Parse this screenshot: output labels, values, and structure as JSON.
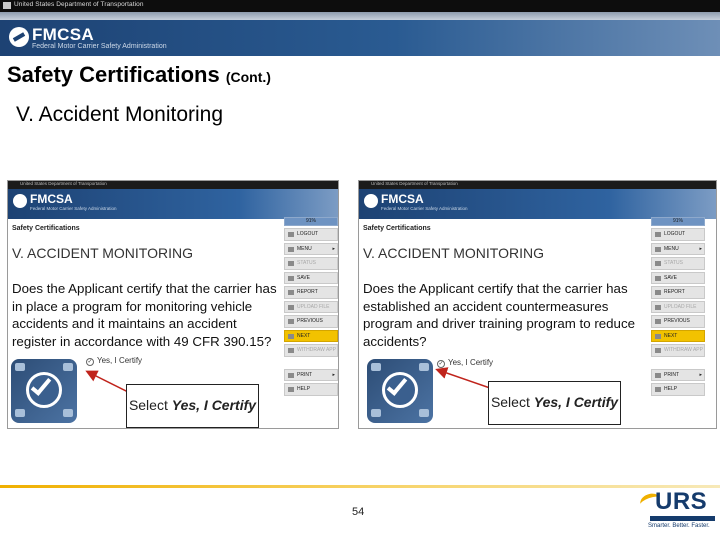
{
  "banner": {
    "dept_label": "United States Department of Transportation",
    "logo_text": "FMCSA",
    "logo_subtitle": "Federal Motor Carrier Safety Administration"
  },
  "slide": {
    "title": "Safety Certifications",
    "title_suffix": "(Cont.)",
    "subtitle": "V. Accident Monitoring"
  },
  "panels": [
    {
      "dept_label": "United States Department of Transportation",
      "logo_text": "FMCSA",
      "logo_subtitle": "Federal Motor Carrier Safety Administration",
      "breadcrumb": "Safety Certifications",
      "heading": "V. ACCIDENT MONITORING",
      "question": "Does the Applicant certify that the carrier has in place a program for monitoring vehicle accidents and it maintains an accident register in accordance with 49 CFR 390.15?",
      "checkbox_label": "Yes, I Certify",
      "menu": {
        "progress": "91%",
        "items": [
          "LOGOUT",
          "MENU",
          "STATUS",
          "SAVE",
          "REPORT",
          "UPLOAD FILE",
          "PREVIOUS",
          "NEXT",
          "WITHDRAW APP",
          "PRINT",
          "HELP"
        ]
      },
      "callout_lead": "Select ",
      "callout_emph": "Yes, I Certify"
    },
    {
      "dept_label": "United States Department of Transportation",
      "logo_text": "FMCSA",
      "logo_subtitle": "Federal Motor Carrier Safety Administration",
      "breadcrumb": "Safety Certifications",
      "heading": "V. ACCIDENT MONITORING",
      "question": "Does the Applicant certify that the carrier has established an accident countermeasures program and driver training program to reduce accidents?",
      "checkbox_label": "Yes, I Certify",
      "menu": {
        "progress": "91%",
        "items": [
          "LOGOUT",
          "MENU",
          "STATUS",
          "SAVE",
          "REPORT",
          "UPLOAD FILE",
          "PREVIOUS",
          "NEXT",
          "WITHDRAW APP",
          "PRINT",
          "HELP"
        ]
      },
      "callout_lead": "Select ",
      "callout_emph": "Yes, I Certify"
    }
  ],
  "footer": {
    "page_number": "54",
    "urs_logo": "URS",
    "urs_tagline": "Smarter. Better. Faster."
  },
  "colors": {
    "banner": "#1a3f6d",
    "next_button": "#f2c200",
    "footer_line": "#f0b000",
    "urs_blue": "#153b6c"
  }
}
